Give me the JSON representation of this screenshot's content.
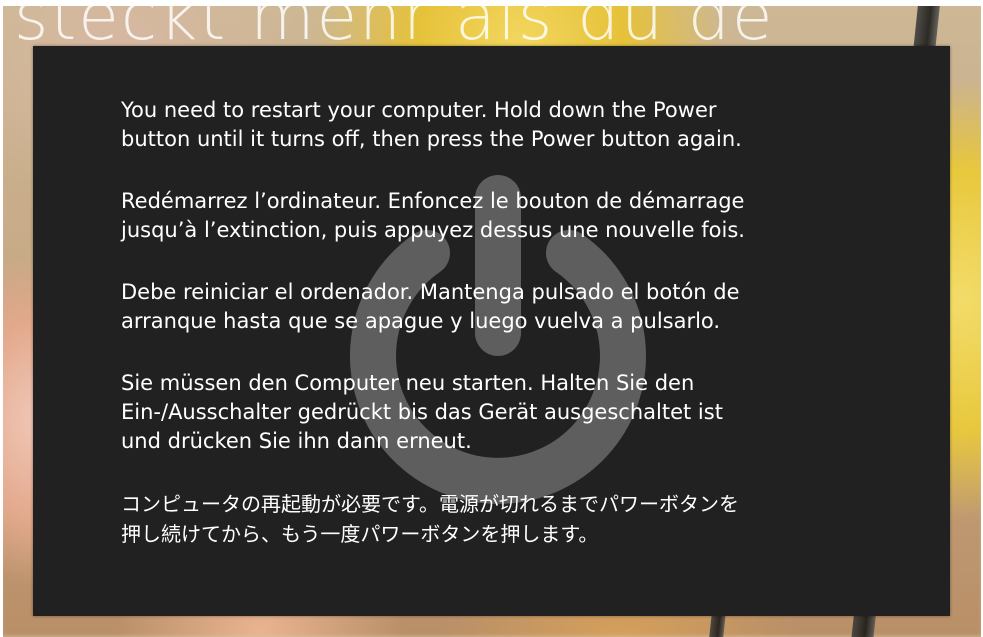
{
  "background": {
    "headline": "steckt mehr als du de"
  },
  "panic": {
    "messages": [
      {
        "lang": "en",
        "text": "You need to restart your computer. Hold down the Power\nbutton until it turns off, then press the Power button again."
      },
      {
        "lang": "fr",
        "text": "Redémarrez l’ordinateur. Enfoncez le bouton de démarrage\njusqu’à l’extinction, puis appuyez dessus une nouvelle fois."
      },
      {
        "lang": "es",
        "text": "Debe reiniciar el ordenador. Mantenga pulsado el botón de\narranque hasta que se apague y luego vuelva a pulsarlo."
      },
      {
        "lang": "de",
        "text": "Sie müssen den Computer neu starten. Halten Sie den\nEin-/Ausschalter gedrückt bis das Gerät ausgeschaltet ist\nund drücken Sie ihn dann erneut."
      },
      {
        "lang": "ja",
        "text": "コンピュータの再起動が必要です。電源が切れるまでパワーボタンを\n押し続けてから、もう一度パワーボタンを押します。"
      }
    ],
    "icon": "power-icon"
  },
  "colors": {
    "panel": "#212121",
    "text": "#ffffff",
    "icon": "#5e5e5e"
  }
}
